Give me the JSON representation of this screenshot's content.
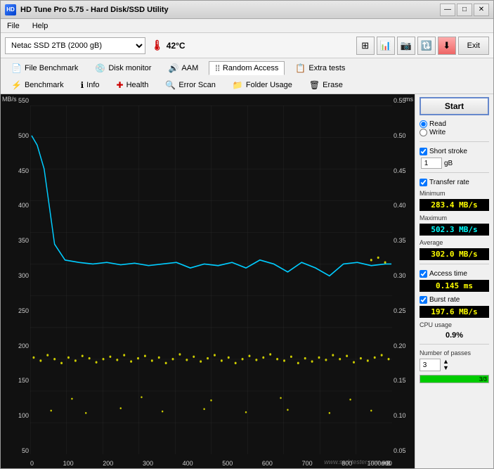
{
  "window": {
    "title": "HD Tune Pro 5.75 - Hard Disk/SSD Utility",
    "icon": "HD"
  },
  "title_buttons": {
    "minimize": "—",
    "maximize": "□",
    "close": "✕"
  },
  "menu": {
    "items": [
      "File",
      "Help"
    ]
  },
  "toolbar": {
    "drive": "Netac SSD 2TB (2000 gB)",
    "temperature": "42°C",
    "exit_label": "Exit"
  },
  "nav": {
    "row1": [
      {
        "label": "File Benchmark",
        "icon": "📄"
      },
      {
        "label": "Disk monitor",
        "icon": "💿"
      },
      {
        "label": "AAM",
        "icon": "🔊"
      },
      {
        "label": "Random Access",
        "icon": "🔀"
      },
      {
        "label": "Extra tests",
        "icon": "📋"
      }
    ],
    "row2": [
      {
        "label": "Benchmark",
        "icon": "⚡"
      },
      {
        "label": "Info",
        "icon": "ℹ"
      },
      {
        "label": "Health",
        "icon": "➕"
      },
      {
        "label": "Error Scan",
        "icon": "🔍"
      },
      {
        "label": "Folder Usage",
        "icon": "📁"
      },
      {
        "label": "Erase",
        "icon": "🗑"
      }
    ]
  },
  "chart": {
    "y_left_unit": "MB/s",
    "y_right_unit": "ms",
    "y_left_labels": [
      "550",
      "500",
      "450",
      "400",
      "350",
      "300",
      "250",
      "200",
      "150",
      "100",
      "50"
    ],
    "y_right_labels": [
      "0.55",
      "0.50",
      "0.45",
      "0.40",
      "0.35",
      "0.30",
      "0.25",
      "0.20",
      "0.15",
      "0.10",
      "0.05"
    ],
    "x_labels": [
      "0",
      "100",
      "200",
      "300",
      "400",
      "500",
      "600",
      "700",
      "800",
      "900",
      "1000mB"
    ],
    "watermark": "www.ssd-tester.com.au"
  },
  "side_panel": {
    "start_label": "Start",
    "read_label": "Read",
    "write_label": "Write",
    "short_stroke_label": "Short stroke",
    "short_stroke_value": "1",
    "short_stroke_unit": "gB",
    "transfer_rate_label": "Transfer rate",
    "minimum_label": "Minimum",
    "minimum_value": "283.4 MB/s",
    "maximum_label": "Maximum",
    "maximum_value": "502.3 MB/s",
    "average_label": "Average",
    "average_value": "302.0 MB/s",
    "access_time_label": "Access time",
    "access_time_value": "0.145 ms",
    "burst_rate_label": "Burst rate",
    "burst_rate_value": "197.6 MB/s",
    "cpu_label": "CPU usage",
    "cpu_value": "0.9%",
    "passes_label": "Number of passes",
    "passes_value": "3",
    "passes_display": "3/3"
  }
}
